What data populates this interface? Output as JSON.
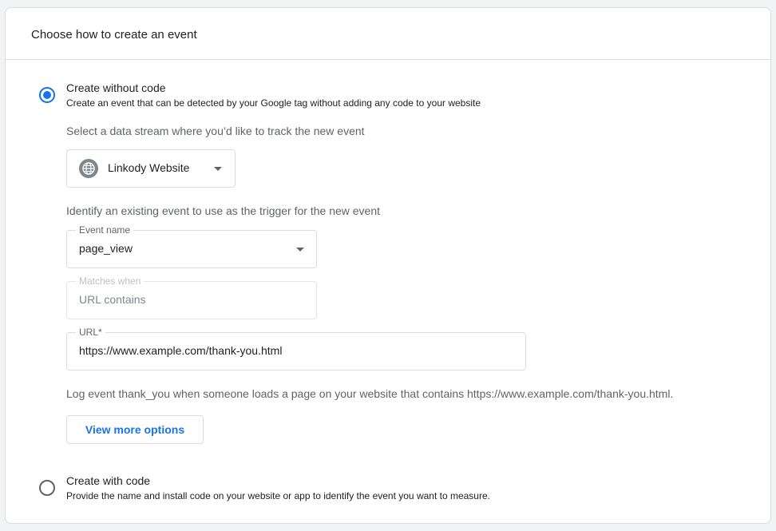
{
  "header": {
    "title": "Choose how to create an event"
  },
  "option_no_code": {
    "title": "Create without code",
    "description": "Create an event that can be detected by your Google tag without adding any code to your website",
    "selected": true
  },
  "stream": {
    "prompt": "Select a data stream where you’d like to track the new event",
    "selected": "Linkody Website",
    "icon": "globe-icon"
  },
  "trigger": {
    "prompt": "Identify an existing event to use as the trigger for the new event",
    "event_name_label": "Event name",
    "event_name_value": "page_view",
    "matches_label": "Matches when",
    "matches_value": "URL contains",
    "url_label": "URL*",
    "url_value": "https://www.example.com/thank-you.html"
  },
  "summary": "Log event thank_you when someone loads a page on your website that contains https://www.example.com/thank-you.html.",
  "more_options_label": "View more options",
  "option_with_code": {
    "title": "Create with code",
    "description": "Provide the name and install code on your website or app to identify the event you want to measure.",
    "selected": false
  },
  "colors": {
    "accent": "#1a73e8",
    "border": "#dadce0",
    "background": "#f1f3f4",
    "muted_text": "#5f6368"
  }
}
